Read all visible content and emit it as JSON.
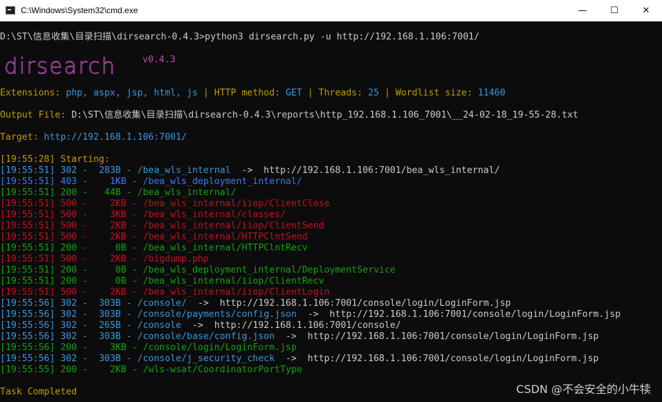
{
  "window": {
    "title": "C:\\Windows\\System32\\cmd.exe",
    "minimize": "—",
    "maximize": "☐",
    "close": "✕"
  },
  "console": {
    "command": "D:\\ST\\信息收集\\目录扫描\\dirsearch-0.4.3>python3 dirsearch.py -u http://192.168.1.106:7001/",
    "logo_text": "dirsearch",
    "version": "v0.4.3",
    "config": {
      "ext_label": "Extensions: ",
      "ext_value": "php, aspx, jsp, html, js",
      "sep": " | ",
      "method_label": "HTTP method: ",
      "method_value": "GET",
      "threads_label": "Threads: ",
      "threads_value": "25",
      "wordlist_label": "Wordlist size: ",
      "wordlist_value": "11460"
    },
    "output": {
      "label": "Output File: ",
      "value": "D:\\ST\\信息收集\\目录扫描\\dirsearch-0.4.3\\reports\\http_192.168.1.106_7001\\__24-02-18_19-55-28.txt"
    },
    "target": {
      "label": "Target: ",
      "value": "http://192.168.1.106:7001/"
    },
    "starting": {
      "time": "[19:55:28]",
      "text": " Starting:"
    },
    "results": [
      {
        "time": "[19:55:51]",
        "code": "302",
        "size": " 283B",
        "path": "/bea_wls_internal",
        "redirect": "  ->  http://192.168.1.106:7001/bea_wls_internal/"
      },
      {
        "time": "[19:55:51]",
        "code": "403",
        "size": "   1KB",
        "path": "/bea_wls_deployment_internal/",
        "redirect": ""
      },
      {
        "time": "[19:55:51]",
        "code": "200",
        "size": "  44B",
        "path": "/bea_wls_internal/",
        "redirect": ""
      },
      {
        "time": "[19:55:51]",
        "code": "500",
        "size": "   2KB",
        "path": "/bea_wls_internal/iiop/ClientClose",
        "redirect": ""
      },
      {
        "time": "[19:55:51]",
        "code": "500",
        "size": "   3KB",
        "path": "/bea_wls_internal/classes/",
        "redirect": ""
      },
      {
        "time": "[19:55:51]",
        "code": "500",
        "size": "   2KB",
        "path": "/bea_wls_internal/iiop/ClientSend",
        "redirect": ""
      },
      {
        "time": "[19:55:51]",
        "code": "500",
        "size": "   2KB",
        "path": "/bea_wls_internal/HTTPClntSend",
        "redirect": ""
      },
      {
        "time": "[19:55:51]",
        "code": "200",
        "size": "    0B",
        "path": "/bea_wls_internal/HTTPClntRecv",
        "redirect": ""
      },
      {
        "time": "[19:55:51]",
        "code": "500",
        "size": "   2KB",
        "path": "/bigdump.php",
        "redirect": ""
      },
      {
        "time": "[19:55:51]",
        "code": "200",
        "size": "    0B",
        "path": "/bea_wls_deployment_internal/DeploymentService",
        "redirect": ""
      },
      {
        "time": "[19:55:51]",
        "code": "200",
        "size": "    0B",
        "path": "/bea_wls_internal/iiop/ClientRecv",
        "redirect": ""
      },
      {
        "time": "[19:55:51]",
        "code": "500",
        "size": "   2KB",
        "path": "/bea_wls_internal/iiop/ClientLogin",
        "redirect": ""
      },
      {
        "time": "[19:55:56]",
        "code": "302",
        "size": " 303B",
        "path": "/console/",
        "redirect": "  ->  http://192.168.1.106:7001/console/login/LoginForm.jsp"
      },
      {
        "time": "[19:55:56]",
        "code": "302",
        "size": " 303B",
        "path": "/console/payments/config.json",
        "redirect": "  ->  http://192.168.1.106:7001/console/login/LoginForm.jsp"
      },
      {
        "time": "[19:55:56]",
        "code": "302",
        "size": " 265B",
        "path": "/console",
        "redirect": "  ->  http://192.168.1.106:7001/console/"
      },
      {
        "time": "[19:55:56]",
        "code": "302",
        "size": " 303B",
        "path": "/console/base/config.json",
        "redirect": "  ->  http://192.168.1.106:7001/console/login/LoginForm.jsp"
      },
      {
        "time": "[19:55:56]",
        "code": "200",
        "size": "   3KB",
        "path": "/console/login/LoginForm.jsp",
        "redirect": ""
      },
      {
        "time": "[19:55:56]",
        "code": "302",
        "size": " 303B",
        "path": "/console/j_security_check",
        "redirect": "  ->  http://192.168.1.106:7001/console/login/LoginForm.jsp"
      },
      {
        "time": "[19:55:55]",
        "code": "200",
        "size": "   2KB",
        "path": "/wls-wsat/CoordinatorPortType",
        "redirect": ""
      }
    ],
    "completed": "Task Completed"
  },
  "watermark": "CSDN @不会安全的小牛犊",
  "colors": {
    "background": "#0c0c0c",
    "green": "#13a10e",
    "red": "#c50f1f",
    "blue": "#3b78ff",
    "cyan": "#3a96dd",
    "yellow": "#c19c00",
    "magenta": "#b54cb4",
    "white": "#cccccc"
  }
}
